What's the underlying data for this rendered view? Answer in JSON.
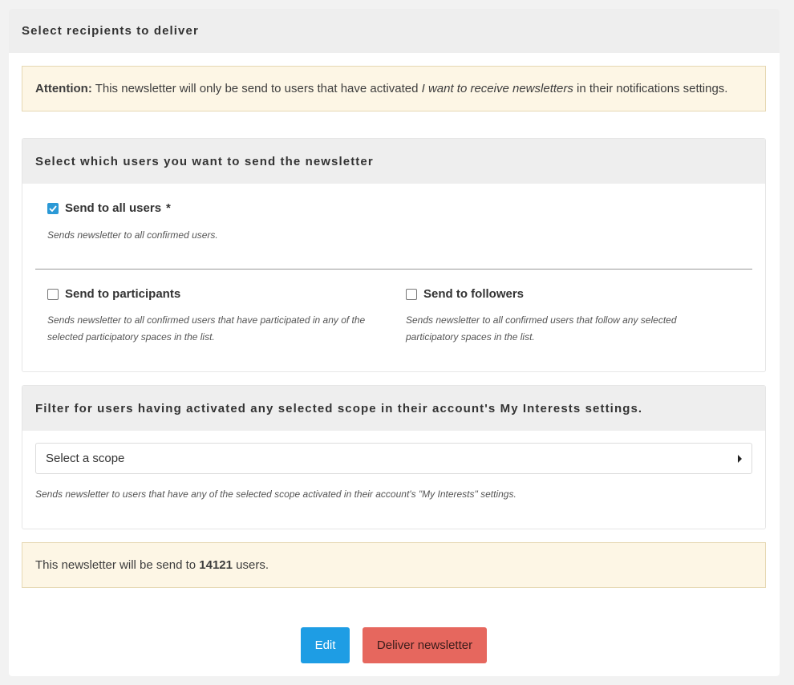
{
  "header": {
    "title": "Select recipients to deliver"
  },
  "attention": {
    "label": "Attention:",
    "text_before": "This newsletter will only be send to users that have activated",
    "setting_name": "I want to receive newsletters",
    "text_after": "in their notifications settings."
  },
  "users_panel": {
    "title": "Select which users you want to send the newsletter",
    "all_users": {
      "label": "Send to all users",
      "required_mark": "*",
      "checked": true,
      "help": "Sends newsletter to all confirmed users."
    },
    "participants": {
      "label": "Send to participants",
      "checked": false,
      "help": "Sends newsletter to all confirmed users that have participated in any of the selected participatory spaces in the list."
    },
    "followers": {
      "label": "Send to followers",
      "checked": false,
      "help": "Sends newsletter to all confirmed users that follow any selected participatory spaces in the list."
    }
  },
  "scope_panel": {
    "title": "Filter for users having activated any selected scope in their account's My Interests settings.",
    "select_placeholder": "Select a scope",
    "help": "Sends newsletter to users that have any of the selected scope activated in their account's \"My Interests\" settings."
  },
  "summary": {
    "text_before": "This newsletter will be send to",
    "count": "14121",
    "text_after": "users."
  },
  "actions": {
    "edit_label": "Edit",
    "deliver_label": "Deliver newsletter"
  },
  "colors": {
    "primary": "#1e9de4",
    "alert": "#e6675e",
    "checkbox_checked": "#2b99d6",
    "callout_bg": "#fdf6e5"
  }
}
